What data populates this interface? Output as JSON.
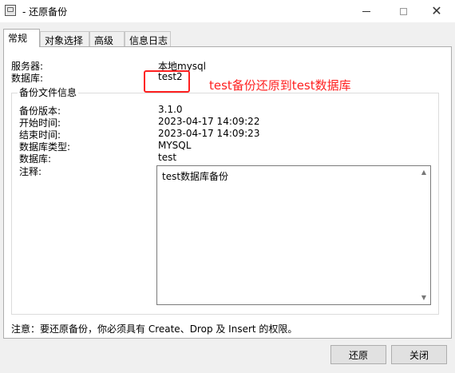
{
  "window": {
    "title": "- 还原备份"
  },
  "tabs": [
    {
      "label": "常规",
      "active": true
    },
    {
      "label": "对象选择",
      "active": false
    },
    {
      "label": "高级",
      "active": false
    },
    {
      "label": "信息日志",
      "active": false
    }
  ],
  "general": {
    "server_label": "服务器:",
    "server_value": "本地mysql",
    "database_label": "数据库:",
    "database_value": "test2"
  },
  "backup_info": {
    "group_title": "备份文件信息",
    "version_label": "备份版本:",
    "version_value": "3.1.0",
    "start_label": "开始时间:",
    "start_value": "2023-04-17 14:09:22",
    "end_label": "结束时间:",
    "end_value": "2023-04-17 14:09:23",
    "dbtype_label": "数据库类型:",
    "dbtype_value": "MYSQL",
    "db_label": "数据库:",
    "db_value": "test",
    "comment_label": "注释:",
    "comment_value": "test数据库备份"
  },
  "annotation": {
    "text": "test备份还原到test数据库",
    "color": "#ff2020"
  },
  "note": "注意：要还原备份，你必须具有 Create、Drop 及 Insert 的权限。",
  "buttons": {
    "restore": "还原",
    "close": "关闭"
  }
}
